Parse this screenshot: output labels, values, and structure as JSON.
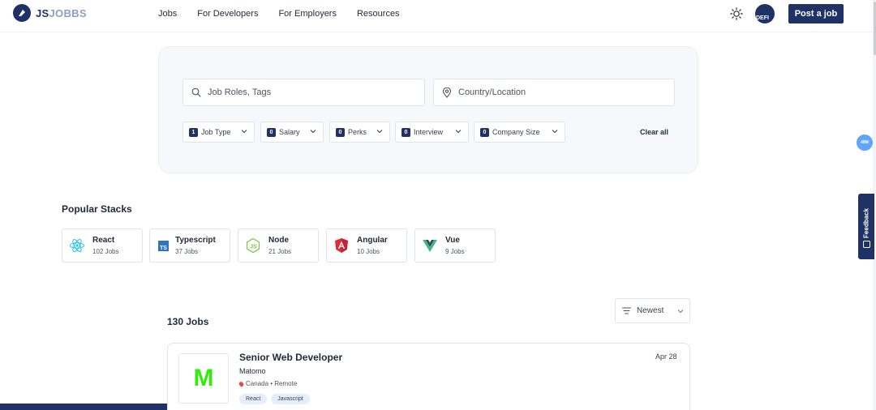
{
  "brand": {
    "logo_bold": "JS",
    "logo_light": "JOBBS",
    "color": "#1f3266"
  },
  "nav": {
    "links": [
      "Jobs",
      "For Developers",
      "For Employers",
      "Resources"
    ],
    "theme_icon": "sun-icon",
    "avatar_text": "DEFI",
    "post_job": "Post a job"
  },
  "side": {
    "memory_badge": "48M",
    "feedback": "Feedback"
  },
  "search": {
    "roles_placeholder": "Job Roles, Tags",
    "location_placeholder": "Country/Location",
    "filters": [
      {
        "count": "1",
        "label": "Job Type"
      },
      {
        "count": "0",
        "label": "Salary"
      },
      {
        "count": "0",
        "label": "Perks"
      },
      {
        "count": "0",
        "label": "Interview"
      },
      {
        "count": "0",
        "label": "Company Size"
      }
    ],
    "clear_all": "Clear all"
  },
  "stacks": {
    "title": "Popular Stacks",
    "items": [
      {
        "name": "React",
        "count": "102 Jobs",
        "icon": "react-icon"
      },
      {
        "name": "Typescript",
        "count": "37 Jobs",
        "icon": "typescript-icon"
      },
      {
        "name": "Node",
        "count": "21 Jobs",
        "icon": "node-icon"
      },
      {
        "name": "Angular",
        "count": "10 Jobs",
        "icon": "angular-icon"
      },
      {
        "name": "Vue",
        "count": "9 Jobs",
        "icon": "vue-icon"
      }
    ]
  },
  "jobs": {
    "count": "130 Jobs",
    "sort": "Newest",
    "list": [
      {
        "logo_letter": "M",
        "title": "Senior Web Developer",
        "company": "Matomo",
        "location": "Canada • Remote",
        "tags": [
          "React",
          "Javascript"
        ],
        "date": "Apr 28"
      }
    ]
  }
}
